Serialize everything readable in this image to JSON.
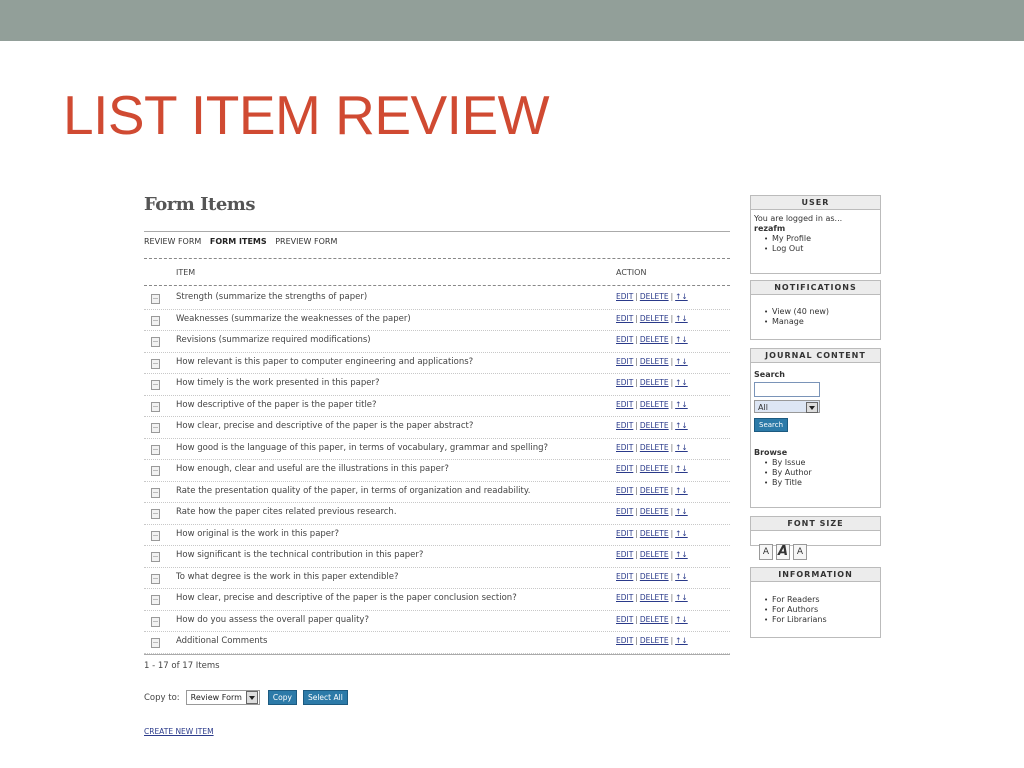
{
  "slide": {
    "title": "LIST ITEM REVIEW"
  },
  "page": {
    "heading": "Form Items",
    "subnav": [
      "REVIEW FORM",
      "FORM ITEMS",
      "PREVIEW FORM"
    ],
    "columns": {
      "item": "ITEM",
      "action": "ACTION"
    },
    "actions": {
      "edit": "EDIT",
      "delete": "DELETE",
      "sep": "|",
      "move": "↑↓"
    },
    "items": [
      "Strength (summarize the strengths of paper)",
      "Weaknesses (summarize the weaknesses of the paper)",
      "Revisions (summarize required modifications)",
      "How relevant is this paper to computer engineering and applications?",
      "How timely is the work presented in this paper?",
      "How descriptive of the paper is the paper title?",
      "How clear, precise and descriptive of the paper is the paper abstract?",
      "How good is the language of this paper, in terms of vocabulary, grammar and spelling?",
      "How enough, clear and useful are the illustrations in this paper?",
      "Rate the presentation quality of the paper, in terms of organization and readability.",
      "Rate how the paper cites related previous research.",
      "How original is the work in this paper?",
      "How significant is the technical contribution in this paper?",
      "To what degree is the work in this paper extendible?",
      "How clear, precise and descriptive of the paper is the paper conclusion section?",
      "How do you assess the overall paper quality?",
      "Additional Comments"
    ],
    "count_text": "1 - 17 of 17 Items",
    "copy_label": "Copy to:",
    "copy_select": "Review Form",
    "copy_button": "Copy",
    "select_all_button": "Select All",
    "create_link": "CREATE NEW ITEM"
  },
  "sidebar": {
    "user": {
      "title": "USER",
      "logged_in": "You are logged in as...",
      "username": "rezafm",
      "links": [
        "My Profile",
        "Log Out"
      ]
    },
    "notifications": {
      "title": "NOTIFICATIONS",
      "links": [
        "View (40 new)",
        "Manage"
      ]
    },
    "journal": {
      "title": "JOURNAL CONTENT",
      "search_label": "Search",
      "search_scope": "All",
      "search_button": "Search",
      "browse_label": "Browse",
      "links": [
        "By Issue",
        "By Author",
        "By Title"
      ]
    },
    "font_size": {
      "title": "FONT SIZE",
      "icons": [
        "A",
        "A",
        "A"
      ]
    },
    "information": {
      "title": "INFORMATION",
      "links": [
        "For Readers",
        "For Authors",
        "For Librarians"
      ]
    }
  }
}
